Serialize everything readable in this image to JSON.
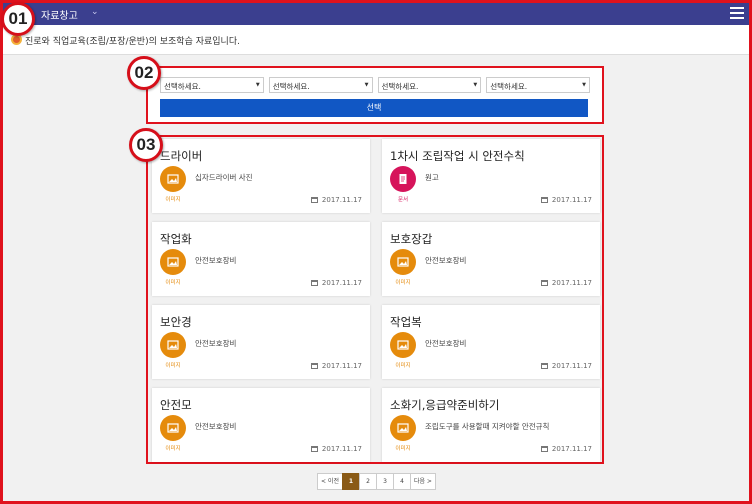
{
  "badges": [
    "01",
    "02",
    "03"
  ],
  "topbar": {
    "title": "자료창고"
  },
  "notice": {
    "text": "진로와 직업교육(조립/포장/운반)의 보조학습 자료입니다."
  },
  "filter": {
    "selects": [
      "선택하세요.",
      "선택하세요.",
      "선택하세요.",
      "선택하세요."
    ],
    "submit_label": "선택"
  },
  "cards": [
    {
      "title": "드라이버",
      "type_label": "이미지",
      "type": "image",
      "desc": "십자드라이버 사진",
      "date": "2017.11.17"
    },
    {
      "title": "1차시 조립작업 시 안전수칙",
      "type_label": "문서",
      "type": "document",
      "desc": "원고",
      "date": "2017.11.17"
    },
    {
      "title": "작업화",
      "type_label": "이미지",
      "type": "image",
      "desc": "안전보호장비",
      "date": "2017.11.17"
    },
    {
      "title": "보호장갑",
      "type_label": "이미지",
      "type": "image",
      "desc": "안전보호장비",
      "date": "2017.11.17"
    },
    {
      "title": "보안경",
      "type_label": "이미지",
      "type": "image",
      "desc": "안전보호장비",
      "date": "2017.11.17"
    },
    {
      "title": "작업복",
      "type_label": "이미지",
      "type": "image",
      "desc": "안전보호장비",
      "date": "2017.11.17"
    },
    {
      "title": "안전모",
      "type_label": "이미지",
      "type": "image",
      "desc": "안전보호장비",
      "date": "2017.11.17"
    },
    {
      "title": "소화기,응급약준비하기",
      "type_label": "이미지",
      "type": "image",
      "desc": "조립도구를 사용할때 지켜야할 안전규칙",
      "date": "2017.11.17"
    }
  ],
  "pager": {
    "prev": "< 이전",
    "pages": [
      "1",
      "2",
      "3",
      "4"
    ],
    "current": "1",
    "next": "다음 >"
  },
  "colors": {
    "topbar": "#3b3f8f",
    "highlight_border": "#e0121d",
    "button": "#1157c4",
    "image_icon": "#e58b0c",
    "document_icon": "#d6145b",
    "pager_active": "#8a5a16"
  }
}
